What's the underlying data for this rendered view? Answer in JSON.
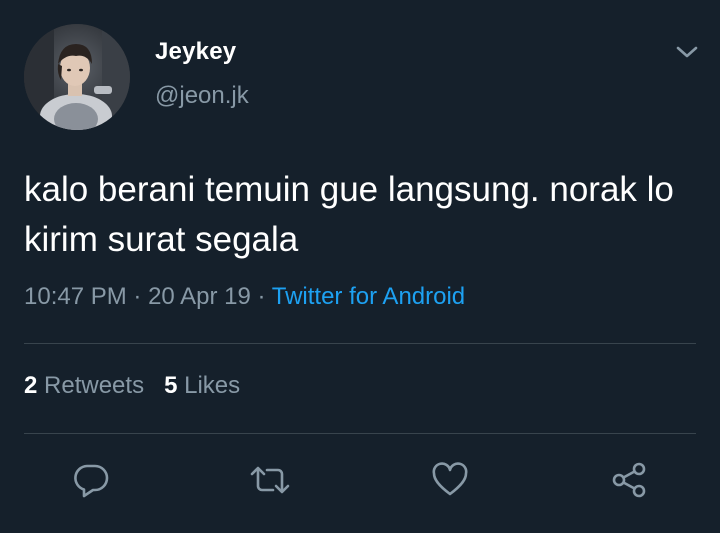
{
  "user": {
    "display_name": "Jeykey",
    "handle": "@jeon.jk"
  },
  "tweet": {
    "text": "kalo berani temuin gue langsung. norak lo kirim surat segala",
    "time": "10:47 PM",
    "date": "20 Apr 19",
    "separator": "·",
    "source": "Twitter for Android"
  },
  "stats": {
    "retweets_count": "2",
    "retweets_label": "Retweets",
    "likes_count": "5",
    "likes_label": "Likes"
  },
  "icons": {
    "menu": "chevron-down-icon",
    "reply": "reply-icon",
    "retweet": "retweet-icon",
    "like": "heart-icon",
    "share": "share-icon"
  },
  "colors": {
    "background": "#15202b",
    "text_primary": "#ffffff",
    "text_secondary": "#8899a6",
    "accent": "#1da1f2",
    "divider": "#38444d"
  }
}
